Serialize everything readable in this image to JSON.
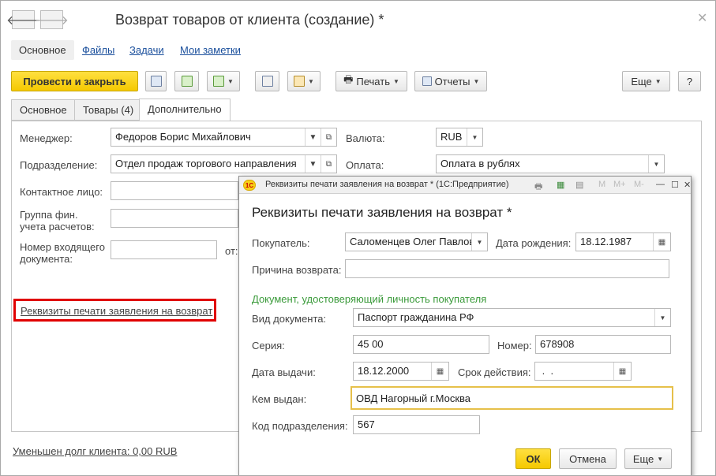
{
  "window": {
    "title": "Возврат товаров от клиента (создание) *"
  },
  "subnav": {
    "main": "Основное",
    "files": "Файлы",
    "tasks": "Задачи",
    "notes": "Мои заметки"
  },
  "toolbar": {
    "post_close": "Провести и закрыть",
    "print": "Печать",
    "reports": "Отчеты",
    "more": "Еще",
    "help": "?"
  },
  "tabs": [
    "Основное",
    "Товары (4)",
    "Дополнительно"
  ],
  "form": {
    "manager_label": "Менеджер:",
    "manager_value": "Федоров Борис Михайлович",
    "division_label": "Подразделение:",
    "division_value": "Отдел продаж торгового направления",
    "contact_label": "Контактное лицо:",
    "fingroup_label": "Группа фин.\nучета расчетов:",
    "incoming_label": "Номер входящего\nдокумента:",
    "from_label": "от:",
    "currency_label": "Валюта:",
    "currency_value": "RUB",
    "payment_label": "Оплата:",
    "payment_value": "Оплата в рублях",
    "print_details_link": "Реквизиты печати заявления на возврат",
    "debt_link": "Уменьшен долг клиента: 0,00 RUB"
  },
  "dialog": {
    "window_title": "Реквизиты печати заявления на возврат * (1С:Предприятие)",
    "logo": "1С",
    "heading": "Реквизиты печати заявления на возврат *",
    "buyer_label": "Покупатель:",
    "buyer_value": "Саломенцев Олег Павлов",
    "birth_label": "Дата рождения:",
    "birth_value": "18.12.1987",
    "reason_label": "Причина возврата:",
    "reason_value": "",
    "section_title": "Документ, удостоверяющий личность покупателя",
    "doctype_label": "Вид документа:",
    "doctype_value": "Паспорт гражданина РФ",
    "series_label": "Серия:",
    "series_value": "45 00",
    "number_label": "Номер:",
    "number_value": "678908",
    "issue_label": "Дата выдачи:",
    "issue_value": "18.12.2000",
    "validity_label": "Срок действия:",
    "validity_value": " .  .",
    "issuer_label": "Кем выдан:",
    "issuer_value": "ОВД Нагорный г.Москва",
    "divcode_label": "Код подразделения:",
    "divcode_value": "567",
    "ok": "ОК",
    "cancel": "Отмена",
    "more": "Еще",
    "tb_m": "M",
    "tb_mplus": "M+",
    "tb_mminus": "M-"
  },
  "colors": {
    "accent_yellow": "#f5c900",
    "link": "#1a4f9c",
    "section_green": "#3a9a3a",
    "highlight_red": "#e00000"
  }
}
